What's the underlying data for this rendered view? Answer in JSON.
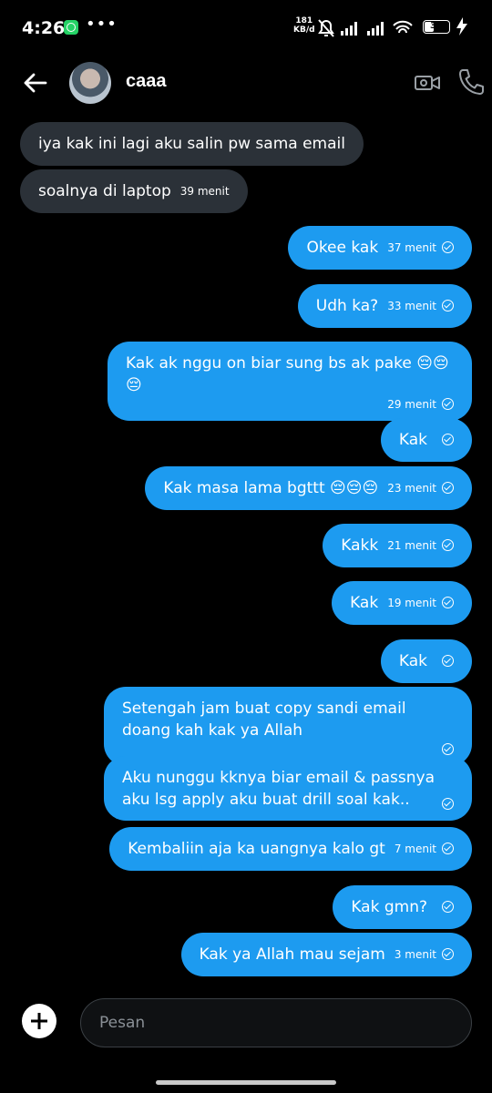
{
  "status_bar": {
    "time": "4:26",
    "dots": "•••",
    "net_speed_value": "181",
    "net_speed_unit": "KB/d",
    "battery": "35"
  },
  "header": {
    "contact_name": "caaa"
  },
  "messages": [
    {
      "direction": "incoming",
      "text": "iya kak ini lagi aku salin pw sama email",
      "time": ""
    },
    {
      "direction": "incoming",
      "text": "soalnya di laptop",
      "time": "39 menit"
    },
    {
      "direction": "outgoing",
      "text": "Okee kak",
      "time": "37 menit"
    },
    {
      "direction": "outgoing",
      "text": "Udh ka?",
      "time": "33 menit"
    },
    {
      "direction": "outgoing",
      "text": "Kak ak nggu on biar sung bs ak pake 😔😔😔",
      "time": "29 menit"
    },
    {
      "direction": "outgoing",
      "text": "Kak",
      "time": ""
    },
    {
      "direction": "outgoing",
      "text": "Kak masa lama bgttt 😔😔😔",
      "time": "23 menit"
    },
    {
      "direction": "outgoing",
      "text": "Kakk",
      "time": "21 menit"
    },
    {
      "direction": "outgoing",
      "text": "Kak",
      "time": "19 menit"
    },
    {
      "direction": "outgoing",
      "text": "Kak",
      "time": ""
    },
    {
      "direction": "outgoing",
      "text": "Setengah jam buat copy sandi email doang kah kak ya Allah",
      "time": ""
    },
    {
      "direction": "outgoing",
      "text": "Aku nunggu kknya biar email & passnya aku lsg apply aku buat drill soal kak..",
      "time": ""
    },
    {
      "direction": "outgoing",
      "text": "Kembaliin aja ka uangnya kalo gt",
      "time": "7 menit"
    },
    {
      "direction": "outgoing",
      "text": "Kak gmn?",
      "time": ""
    },
    {
      "direction": "outgoing",
      "text": "Kak ya Allah mau sejam",
      "time": "3 menit"
    }
  ],
  "composer": {
    "placeholder": "Pesan"
  }
}
